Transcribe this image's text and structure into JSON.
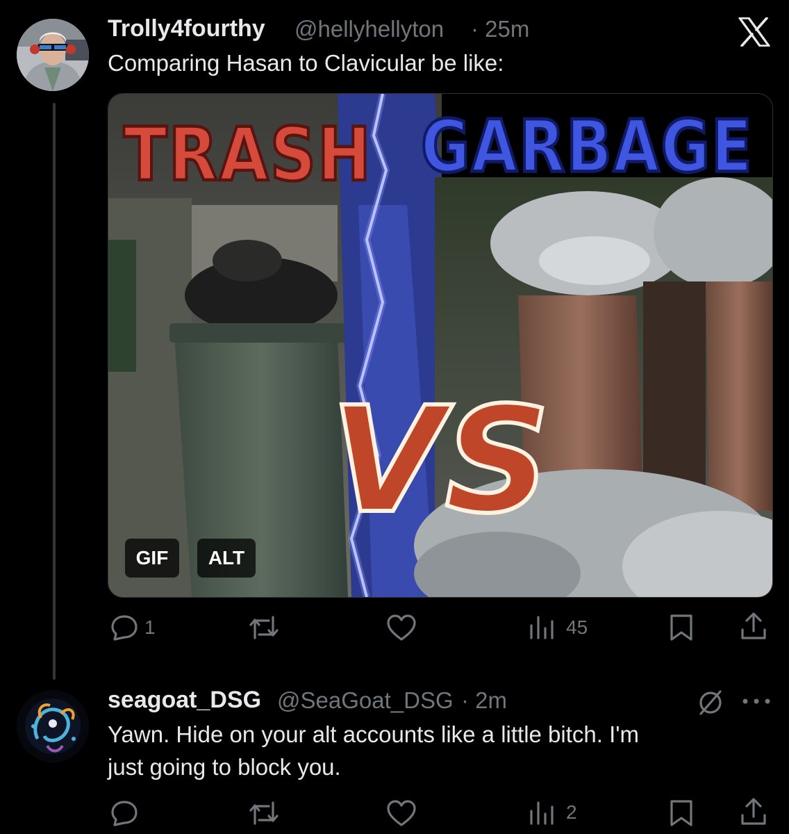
{
  "app": {
    "logo": "x-logo-icon"
  },
  "thread": {
    "tweet": {
      "author": {
        "display_name": "Trolly4fourthy",
        "handle": "@hellyhellyton",
        "time": "· 25m"
      },
      "text": "Comparing Hasan to Clavicular be like:",
      "media": {
        "type": "gif",
        "badges": {
          "gif": "GIF",
          "alt": "ALT"
        },
        "meme_text": {
          "left": "TRASH",
          "center": "VS",
          "right": "GARBAGE"
        }
      },
      "actions": {
        "reply_count": "1",
        "repost_count": "",
        "like_count": "",
        "views_count": "45"
      }
    },
    "reply": {
      "author": {
        "display_name": "seagoat_DSG",
        "handle": "@SeaGoat_DSG",
        "time": "· 2m"
      },
      "text_line1": "Yawn. Hide on your alt accounts like a little bitch. I'm",
      "text_line2": "just going to block you.",
      "actions": {
        "reply_count": "",
        "repost_count": "",
        "like_count": "",
        "views_count": "2"
      }
    }
  },
  "colors": {
    "background": "#000000",
    "text_primary": "#e7e9ea",
    "text_secondary": "#71767b",
    "thread_line": "#333639"
  }
}
